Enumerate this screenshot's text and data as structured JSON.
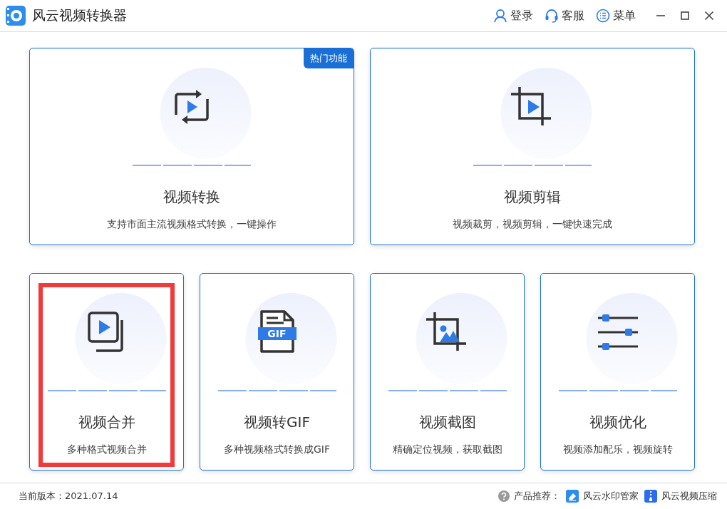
{
  "window": {
    "title": "风云视频转换器",
    "actions": [
      {
        "kind": "user",
        "label": "登录"
      },
      {
        "kind": "support",
        "label": "客服"
      },
      {
        "kind": "menu",
        "label": "菜单"
      }
    ]
  },
  "cards": [
    {
      "kind": "convert",
      "title": "视频转换",
      "description": "支持市面主流视频格式转换，一键操作",
      "badge": "热门功能",
      "highlighted": false
    },
    {
      "kind": "edit",
      "title": "视频剪辑",
      "description": "视频裁剪，视频剪辑，一键快速完成",
      "highlighted": false
    },
    {
      "kind": "merge",
      "title": "视频合并",
      "description": "多种格式视频合并",
      "highlighted": true
    },
    {
      "kind": "gif",
      "title": "视频转GIF",
      "description": "多种视频格式转换成GIF",
      "icon_text": "GIF",
      "highlighted": false
    },
    {
      "kind": "screenshot",
      "title": "视频截图",
      "description": "精确定位视频，获取截图",
      "highlighted": false
    },
    {
      "kind": "optimize",
      "title": "视频优化",
      "description": "视频添加配乐，视频旋转",
      "highlighted": false
    }
  ],
  "status_bar": {
    "version": "当前版本：2021.07.14",
    "recommend_label": "产品推荐：",
    "products": [
      {
        "kind": "watermark",
        "label": "风云水印管家"
      },
      {
        "kind": "compress",
        "label": "风云视频压缩"
      }
    ]
  }
}
